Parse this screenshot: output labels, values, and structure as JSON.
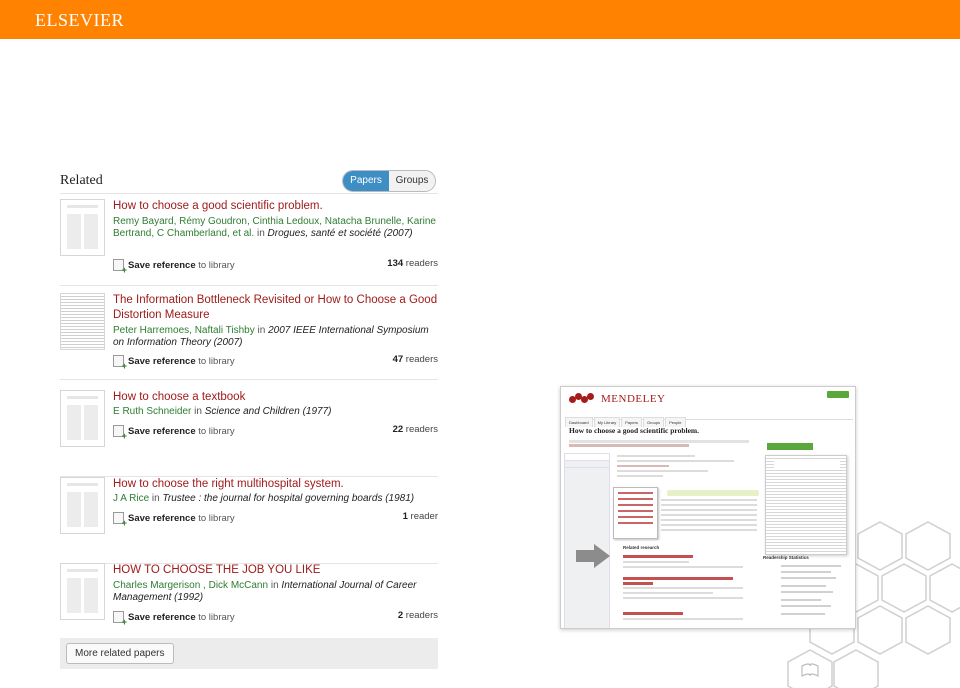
{
  "brand": {
    "logo_text": "ELSEVIER",
    "color": "#ff8200"
  },
  "related": {
    "title": "Related",
    "tabs": [
      "Papers",
      "Groups"
    ],
    "active_tab": "Papers",
    "save_label": "Save reference",
    "save_suffix": "to library",
    "items": [
      {
        "title": "How to choose a good scientific problem.",
        "authors": "Remy Bayard, Rémy Goudron, Cinthia Ledoux, Natacha Brunelle, Karine Bertrand, C Chamberland, et al.",
        "in": "in",
        "journal": "Drogues, santé et société (2007)",
        "readers_count": "134",
        "readers_label": "readers"
      },
      {
        "title": "The Information Bottleneck Revisited or How to Choose a Good Distortion Measure",
        "authors": "Peter Harremoes, Naftali Tishby",
        "in": "in",
        "journal": "2007 IEEE International Symposium on Information Theory (2007)",
        "readers_count": "47",
        "readers_label": "readers"
      },
      {
        "title": "How to choose a textbook",
        "authors": "E Ruth Schneider",
        "in": "in",
        "journal": "Science and Children (1977)",
        "readers_count": "22",
        "readers_label": "readers"
      },
      {
        "title": "How to choose the right multihospital system.",
        "authors": "J A Rice",
        "in": "in",
        "journal": "Trustee : the journal for hospital governing boards (1981)",
        "readers_count": "1",
        "readers_label": "reader"
      },
      {
        "title": "HOW TO CHOOSE THE JOB YOU LIKE",
        "authors": "Charles Margerison , Dick McCann",
        "in": "in",
        "journal": "International Journal of Career Management (1992)",
        "readers_count": "2",
        "readers_label": "readers"
      }
    ],
    "more_button": "More related papers"
  },
  "mendeley_screenshot": {
    "app_name": "MENDELEY",
    "nav": [
      "Dashboard",
      "My Library",
      "Papers",
      "Groups",
      "People"
    ],
    "paper_title": "How to choose a good scientific problem.",
    "related_heading": "Related research",
    "stats_heading": "Readership Statistics"
  }
}
